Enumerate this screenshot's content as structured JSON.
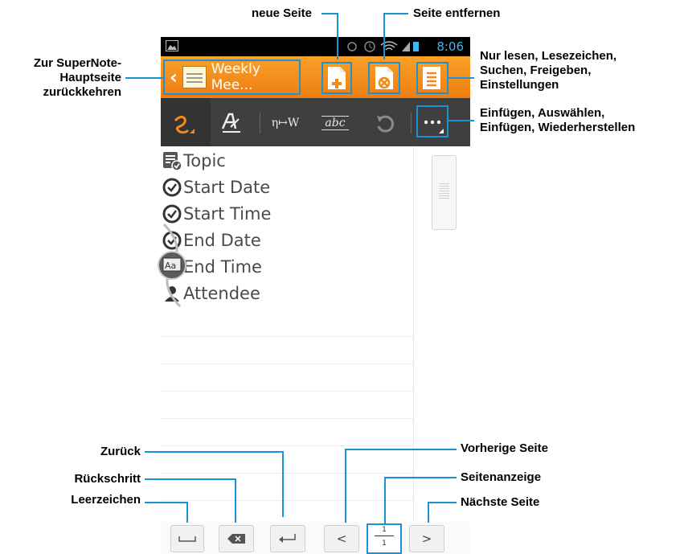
{
  "status_bar": {
    "time": "8:06"
  },
  "action_bar": {
    "notebook_title": "Weekly Mee...",
    "icons": [
      "back-chevron-icon",
      "notebook-icon",
      "new-page-icon",
      "remove-page-icon",
      "overflow-menu-icon"
    ]
  },
  "toolbar": {
    "text_tool": "η↦W",
    "abc_tool": "abc"
  },
  "template_fields": [
    {
      "label": "Topic",
      "icon": "checklist-icon"
    },
    {
      "label": "Start Date",
      "icon": "clock-icon"
    },
    {
      "label": "Start Time",
      "icon": "clock-icon"
    },
    {
      "label": "End Date",
      "icon": "clock-icon"
    },
    {
      "label": "End Time",
      "icon": "clock-icon"
    },
    {
      "label": "Attendee",
      "icon": "person-icon"
    }
  ],
  "keyboard_bar": {
    "prev_label": "<",
    "next_label": ">",
    "page_current": "1",
    "page_total": "1"
  },
  "callouts": {
    "new_page": "neue Seite",
    "remove_page": "Seite entfernen",
    "back_home_1": "Zur SuperNote-",
    "back_home_2": "Hauptseite",
    "back_home_3": "zurückkehren",
    "menu_1": "Nur lesen, Lesezeichen,",
    "menu_2": "Suchen, Freigeben,",
    "menu_3": "Einstellungen",
    "more_1": "Einfügen, Auswählen,",
    "more_2": "Einfügen, Wiederherstellen",
    "back": "Zurück",
    "backspace": "Rückschritt",
    "space": "Leerzeichen",
    "prev_page": "Vorherige Seite",
    "page_indicator": "Seitenanzeige",
    "next_page": "Nächste Seite"
  },
  "colors": {
    "accent": "#f28b18",
    "callout_line": "#1a93d4",
    "toolbar": "#3f3f3f"
  }
}
